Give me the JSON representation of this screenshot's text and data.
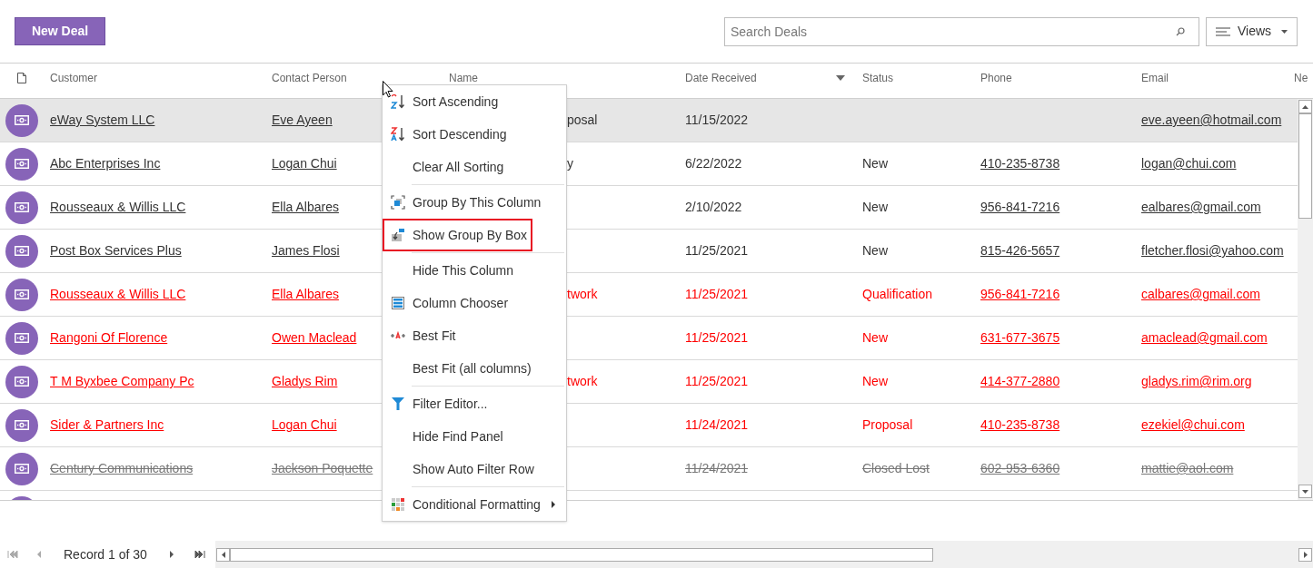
{
  "toolbar": {
    "new_button": "New Deal",
    "search": {
      "placeholder": "Search Deals"
    },
    "views_button": "Views"
  },
  "table": {
    "columns": [
      {
        "label": "Customer",
        "sorted": false
      },
      {
        "label": "Contact Person",
        "sorted": false
      },
      {
        "label": "Name",
        "sorted": false
      },
      {
        "label": "Date Received",
        "sorted": true
      },
      {
        "label": "Status",
        "sorted": false
      },
      {
        "label": "Phone",
        "sorted": false
      },
      {
        "label": "Email",
        "sorted": false
      },
      {
        "label": "Ne",
        "sorted": false
      }
    ],
    "rows": [
      {
        "customer": "eWay System LLC",
        "contact": "Eve Ayeen",
        "name": "posal",
        "date": "11/15/2022",
        "status": "",
        "phone": "",
        "email": "eve.ayeen@hotmail.com",
        "selected": true,
        "kind": "normal"
      },
      {
        "customer": "Abc Enterprises Inc",
        "contact": "Logan Chui",
        "name": "y",
        "date": "6/22/2022",
        "status": "New",
        "phone": "410-235-8738",
        "email": "logan@chui.com",
        "selected": false,
        "kind": "normal"
      },
      {
        "customer": "Rousseaux & Willis LLC",
        "contact": "Ella Albares",
        "name": "",
        "date": "2/10/2022",
        "status": "New",
        "phone": "956-841-7216",
        "email": "ealbares@gmail.com",
        "selected": false,
        "kind": "normal"
      },
      {
        "customer": "Post Box Services Plus",
        "contact": "James Flosi",
        "name": "",
        "date": "11/25/2021",
        "status": "New",
        "phone": "815-426-5657",
        "email": "fletcher.flosi@yahoo.com",
        "selected": false,
        "kind": "normal"
      },
      {
        "customer": "Rousseaux & Willis LLC",
        "contact": "Ella Albares",
        "name": "twork",
        "date": "11/25/2021",
        "status": "Qualification",
        "phone": "956-841-7216",
        "email": "calbares@gmail.com",
        "selected": false,
        "kind": "alert"
      },
      {
        "customer": "Rangoni Of Florence",
        "contact": "Owen Maclead",
        "name": "",
        "date": "11/25/2021",
        "status": "New",
        "phone": "631-677-3675",
        "email": "amaclead@gmail.com",
        "selected": false,
        "kind": "alert"
      },
      {
        "customer": "T M Byxbee Company Pc",
        "contact": "Gladys Rim",
        "name": "twork",
        "date": "11/25/2021",
        "status": "New",
        "phone": "414-377-2880",
        "email": "gladys.rim@rim.org",
        "selected": false,
        "kind": "alert"
      },
      {
        "customer": "Sider & Partners Inc",
        "contact": "Logan Chui",
        "name": "",
        "date": "11/24/2021",
        "status": "Proposal",
        "phone": "410-235-8738",
        "email": "ezekiel@chui.com",
        "selected": false,
        "kind": "alert"
      },
      {
        "customer": "Century Communications",
        "contact": "Jackson Poquette",
        "name": "",
        "date": "11/24/2021",
        "status": "Closed Lost",
        "phone": "602-953-6360",
        "email": "mattie@aol.com",
        "selected": false,
        "kind": "lost"
      }
    ]
  },
  "context_menu": {
    "items": [
      {
        "label": "Sort Ascending",
        "kind": "sort-asc",
        "highlighted": false,
        "divider_after": false,
        "submenu": false
      },
      {
        "label": "Sort Descending",
        "kind": "sort-desc",
        "highlighted": false,
        "divider_after": false,
        "submenu": false
      },
      {
        "label": "Clear All Sorting",
        "kind": "none",
        "highlighted": false,
        "divider_after": true,
        "submenu": false
      },
      {
        "label": "Group By This Column",
        "kind": "group-column",
        "highlighted": false,
        "divider_after": false,
        "submenu": false
      },
      {
        "label": "Show Group By Box",
        "kind": "group-box",
        "highlighted": true,
        "divider_after": true,
        "submenu": false
      },
      {
        "label": "Hide This Column",
        "kind": "none",
        "highlighted": false,
        "divider_after": false,
        "submenu": false
      },
      {
        "label": "Column Chooser",
        "kind": "column-chooser",
        "highlighted": false,
        "divider_after": false,
        "submenu": false
      },
      {
        "label": "Best Fit",
        "kind": "best-fit",
        "highlighted": false,
        "divider_after": false,
        "submenu": false
      },
      {
        "label": "Best Fit (all columns)",
        "kind": "none",
        "highlighted": false,
        "divider_after": true,
        "submenu": false
      },
      {
        "label": "Filter Editor...",
        "kind": "filter",
        "highlighted": false,
        "divider_after": false,
        "submenu": false
      },
      {
        "label": "Hide Find Panel",
        "kind": "none",
        "highlighted": false,
        "divider_after": false,
        "submenu": false
      },
      {
        "label": "Show Auto Filter Row",
        "kind": "none",
        "highlighted": false,
        "divider_after": true,
        "submenu": false
      },
      {
        "label": "Conditional Formatting",
        "kind": "cond-format",
        "highlighted": false,
        "divider_after": false,
        "submenu": true
      }
    ]
  },
  "footer": {
    "record_text": "Record 1 of 30"
  }
}
